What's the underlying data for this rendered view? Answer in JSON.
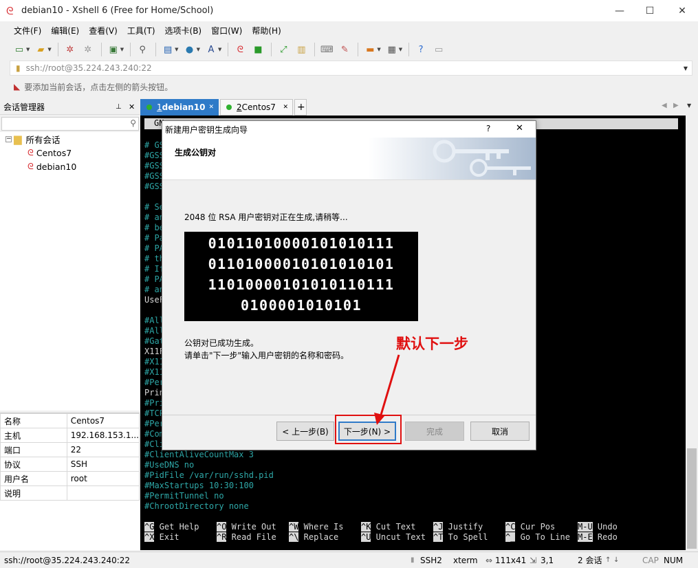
{
  "window": {
    "title": "debian10 - Xshell 6 (Free for Home/School)",
    "minimize": "—",
    "maximize": "☐",
    "close": "✕"
  },
  "menu": [
    "文件(F)",
    "编辑(E)",
    "查看(V)",
    "工具(T)",
    "选项卡(B)",
    "窗口(W)",
    "帮助(H)"
  ],
  "address": {
    "value": "ssh://root@35.224.243.240:22"
  },
  "hint": "要添加当前会话，点击左侧的箭头按钮。",
  "session_manager": {
    "title": "会话管理器",
    "root": "所有会话",
    "items": [
      "Centos7",
      "debian10"
    ]
  },
  "properties": [
    {
      "key": "名称",
      "value": "Centos7"
    },
    {
      "key": "主机",
      "value": "192.168.153.1..."
    },
    {
      "key": "端口",
      "value": "22"
    },
    {
      "key": "协议",
      "value": "SSH"
    },
    {
      "key": "用户名",
      "value": "root"
    },
    {
      "key": "说明",
      "value": ""
    }
  ],
  "tabs": [
    {
      "num": "1",
      "label": " debian10"
    },
    {
      "num": "2",
      "label": " Centos7"
    }
  ],
  "terminal": {
    "header": "GN",
    "lines_left": [
      "# GS",
      "#GSS",
      "#GSS",
      "#GSS",
      "#GSS",
      "",
      "# Se",
      "# an",
      "# be",
      "# Pa",
      "# PA",
      "# th",
      "# If",
      "# PA",
      "# an",
      "UseF",
      "",
      "#All",
      "#All",
      "#Gat",
      "X11F",
      "#X11",
      "#X11",
      "#Per",
      "Prin",
      "#Pri",
      "#TCP",
      "#Per",
      "#Com",
      "#Cli"
    ],
    "lines_full": [
      "#ClientAliveCountMax 3",
      "#UseDNS no",
      "#PidFile /var/run/sshd.pid",
      "#MaxStartups 10:30:100",
      "#PermitTunnel no",
      "#ChrootDirectory none"
    ],
    "nano": [
      {
        "k1": "^G",
        "t1": " Get Help",
        "k2": "^X",
        "t2": " Exit"
      },
      {
        "k1": "^O",
        "t1": " Write Out",
        "k2": "^R",
        "t2": " Read File"
      },
      {
        "k1": "^W",
        "t1": " Where Is",
        "k2": "^\\",
        "t2": " Replace"
      },
      {
        "k1": "^K",
        "t1": " Cut Text",
        "k2": "^U",
        "t2": " Uncut Text"
      },
      {
        "k1": "^J",
        "t1": " Justify",
        "k2": "^T",
        "t2": " To Spell"
      },
      {
        "k1": "^C",
        "t1": " Cur Pos",
        "k2": "^_",
        "t2": " Go To Line"
      },
      {
        "k1": "M-U",
        "t1": " Undo",
        "k2": "M-E",
        "t2": " Redo"
      }
    ]
  },
  "dialog": {
    "title": "新建用户密钥生成向导",
    "help": "?",
    "close": "✕",
    "heading": "生成公钥对",
    "status": "2048 位 RSA 用户密钥对正在生成,请稍等...",
    "binary": [
      "01011010000101010111",
      "01101000010101010101",
      "11010000101010110111",
      "0100001010101"
    ],
    "done_line1": "公钥对已成功生成。",
    "done_line2": "请单击\"下一步\"输入用户密钥的名称和密码。",
    "btn_back": "< 上一步(B)",
    "btn_next": "下一步(N) >",
    "btn_finish": "完成",
    "btn_cancel": "取消"
  },
  "annotation": "默认下一步",
  "status": {
    "left": "ssh://root@35.224.243.240:22",
    "proto": "SSH2",
    "term": "xterm",
    "size": "111x41",
    "pos": "3,1",
    "sessions": "2 会话",
    "cap": "CAP",
    "num": "NUM"
  },
  "colors": {
    "tab_active": "#2e7ac8",
    "terminal_text": "#2ea8a8",
    "annotation": "#e01010"
  }
}
